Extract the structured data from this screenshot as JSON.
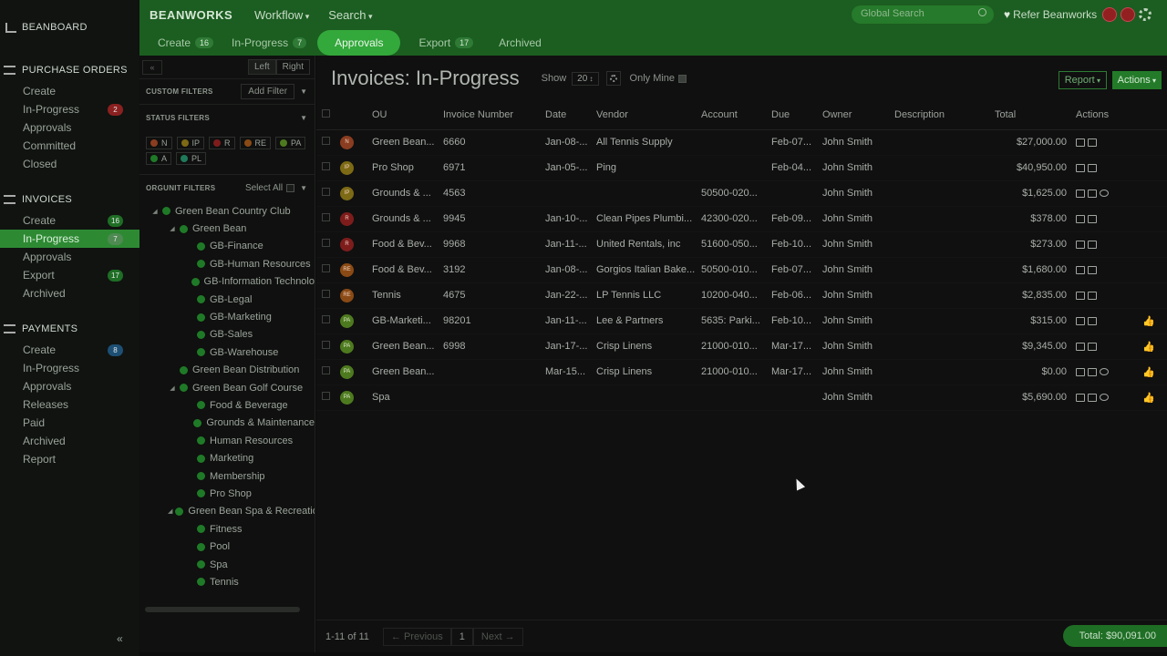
{
  "sidebar": {
    "home_label": "BEANBOARD",
    "purchase_orders": {
      "title": "PURCHASE ORDERS",
      "items": [
        {
          "label": "Create",
          "badge": ""
        },
        {
          "label": "In-Progress",
          "badge": "2"
        },
        {
          "label": "Approvals",
          "badge": ""
        },
        {
          "label": "Committed",
          "badge": ""
        },
        {
          "label": "Closed",
          "badge": ""
        }
      ]
    },
    "invoices": {
      "title": "INVOICES",
      "items": [
        {
          "label": "Create",
          "badge": "16"
        },
        {
          "label": "In-Progress",
          "badge": "7"
        },
        {
          "label": "Approvals",
          "badge": ""
        },
        {
          "label": "Export",
          "badge": "17"
        },
        {
          "label": "Archived",
          "badge": ""
        }
      ]
    },
    "payments": {
      "title": "PAYMENTS",
      "items": [
        {
          "label": "Create",
          "badge": "8"
        },
        {
          "label": "In-Progress",
          "badge": ""
        },
        {
          "label": "Approvals",
          "badge": ""
        },
        {
          "label": "Releases",
          "badge": ""
        },
        {
          "label": "Paid",
          "badge": ""
        },
        {
          "label": "Archived",
          "badge": ""
        },
        {
          "label": "Report",
          "badge": ""
        }
      ]
    },
    "collapse_label": "«"
  },
  "topbar": {
    "brand": "BEANWORKS",
    "menu": [
      "Workflow",
      "Search"
    ],
    "search_placeholder": "Global Search",
    "refer_label": "Refer Beanworks"
  },
  "subnav": {
    "tabs": [
      {
        "label": "Create",
        "count": "16"
      },
      {
        "label": "In-Progress",
        "count": "7"
      },
      {
        "label": "Approvals",
        "count": ""
      },
      {
        "label": "Export",
        "count": "17"
      },
      {
        "label": "Archived",
        "count": ""
      }
    ]
  },
  "filters": {
    "collapse": "«",
    "left": "Left",
    "right": "Right",
    "custom_title": "CUSTOM FILTERS",
    "add_filter": "Add Filter",
    "status_title": "STATUS FILTERS",
    "status_chips": [
      {
        "label": "N",
        "color": "#8a3d20"
      },
      {
        "label": "IP",
        "color": "#7d6a15"
      },
      {
        "label": "R",
        "color": "#7e1c1c"
      },
      {
        "label": "RE",
        "color": "#8a4a15"
      },
      {
        "label": "PA",
        "color": "#4e7a1f"
      },
      {
        "label": "A",
        "color": "#1f7a27"
      },
      {
        "label": "PL",
        "color": "#1f7a5a"
      }
    ],
    "orgunit_title": "ORGUNIT FILTERS",
    "select_all": "Select All",
    "tree": [
      {
        "label": "Green Bean Country Club",
        "level": 0,
        "toggle": "◢"
      },
      {
        "label": "Green Bean",
        "level": 1,
        "toggle": "◢"
      },
      {
        "label": "GB-Finance",
        "level": 2,
        "toggle": ""
      },
      {
        "label": "GB-Human Resources",
        "level": 2,
        "toggle": ""
      },
      {
        "label": "GB-Information Technolo",
        "level": 2,
        "toggle": ""
      },
      {
        "label": "GB-Legal",
        "level": 2,
        "toggle": ""
      },
      {
        "label": "GB-Marketing",
        "level": 2,
        "toggle": ""
      },
      {
        "label": "GB-Sales",
        "level": 2,
        "toggle": ""
      },
      {
        "label": "GB-Warehouse",
        "level": 2,
        "toggle": ""
      },
      {
        "label": "Green Bean Distribution",
        "level": 1,
        "toggle": ""
      },
      {
        "label": "Green Bean Golf Course",
        "level": 1,
        "toggle": "◢"
      },
      {
        "label": "Food & Beverage",
        "level": 2,
        "toggle": ""
      },
      {
        "label": "Grounds & Maintenance",
        "level": 2,
        "toggle": ""
      },
      {
        "label": "Human Resources",
        "level": 2,
        "toggle": ""
      },
      {
        "label": "Marketing",
        "level": 2,
        "toggle": ""
      },
      {
        "label": "Membership",
        "level": 2,
        "toggle": ""
      },
      {
        "label": "Pro Shop",
        "level": 2,
        "toggle": ""
      },
      {
        "label": "Green Bean Spa & Recreation",
        "level": 1,
        "toggle": "◢"
      },
      {
        "label": "Fitness",
        "level": 2,
        "toggle": ""
      },
      {
        "label": "Pool",
        "level": 2,
        "toggle": ""
      },
      {
        "label": "Spa",
        "level": 2,
        "toggle": ""
      },
      {
        "label": "Tennis",
        "level": 2,
        "toggle": ""
      }
    ]
  },
  "main": {
    "title": "Invoices: In-Progress",
    "show_label": "Show",
    "show_value": "20",
    "only_mine": "Only Mine",
    "report_btn": "Report",
    "actions_btn": "Actions",
    "columns": [
      "OU",
      "Invoice Number",
      "Date",
      "Vendor",
      "Account",
      "Due",
      "Owner",
      "Description",
      "Total",
      "Actions"
    ],
    "rows": [
      {
        "status": "N",
        "ou": "Green Bean...",
        "inv": "6660",
        "date": "Jan-08-...",
        "vendor": "All Tennis Supply",
        "account": "",
        "due": "Feb-07...",
        "owner": "John Smith",
        "desc": "",
        "total": "$27,000.00",
        "bubble": false,
        "thumb": false
      },
      {
        "status": "IP",
        "ou": "Pro Shop",
        "inv": "6971",
        "date": "Jan-05-...",
        "vendor": "Ping",
        "account": "",
        "due": "Feb-04...",
        "owner": "John Smith",
        "desc": "",
        "total": "$40,950.00",
        "bubble": false,
        "thumb": false
      },
      {
        "status": "IP",
        "ou": "Grounds & ...",
        "inv": "4563",
        "date": "",
        "vendor": "",
        "account": "50500-020...",
        "due": "",
        "owner": "John Smith",
        "desc": "",
        "total": "$1,625.00",
        "bubble": true,
        "thumb": false
      },
      {
        "status": "R",
        "ou": "Grounds & ...",
        "inv": "9945",
        "date": "Jan-10-...",
        "vendor": "Clean Pipes Plumbi...",
        "account": "42300-020...",
        "due": "Feb-09...",
        "owner": "John Smith",
        "desc": "",
        "total": "$378.00",
        "bubble": false,
        "thumb": false
      },
      {
        "status": "R",
        "ou": "Food & Bev...",
        "inv": "9968",
        "date": "Jan-11-...",
        "vendor": "United Rentals, inc",
        "account": "51600-050...",
        "due": "Feb-10...",
        "owner": "John Smith",
        "desc": "",
        "total": "$273.00",
        "bubble": false,
        "thumb": false
      },
      {
        "status": "RE",
        "ou": "Food & Bev...",
        "inv": "3192",
        "date": "Jan-08-...",
        "vendor": "Gorgios Italian Bake...",
        "account": "50500-010...",
        "due": "Feb-07...",
        "owner": "John Smith",
        "desc": "",
        "total": "$1,680.00",
        "bubble": false,
        "thumb": false
      },
      {
        "status": "RE",
        "ou": "Tennis",
        "inv": "4675",
        "date": "Jan-22-...",
        "vendor": "LP Tennis LLC",
        "account": "10200-040...",
        "due": "Feb-06...",
        "owner": "John Smith",
        "desc": "",
        "total": "$2,835.00",
        "bubble": false,
        "thumb": false
      },
      {
        "status": "PA",
        "ou": "GB-Marketi...",
        "inv": "98201",
        "date": "Jan-11-...",
        "vendor": "Lee & Partners",
        "account": "5635: Parki...",
        "due": "Feb-10...",
        "owner": "John Smith",
        "desc": "",
        "total": "$315.00",
        "bubble": false,
        "thumb": true
      },
      {
        "status": "PA",
        "ou": "Green Bean...",
        "inv": "6998",
        "date": "Jan-17-...",
        "vendor": "Crisp Linens",
        "account": "21000-010...",
        "due": "Mar-17...",
        "owner": "John Smith",
        "desc": "",
        "total": "$9,345.00",
        "bubble": false,
        "thumb": true
      },
      {
        "status": "PA",
        "ou": "Green Bean...",
        "inv": "",
        "date": "Mar-15...",
        "vendor": "Crisp Linens",
        "account": "21000-010...",
        "due": "Mar-17...",
        "owner": "John Smith",
        "desc": "",
        "total": "$0.00",
        "bubble": true,
        "thumb": true
      },
      {
        "status": "PA",
        "ou": "Spa",
        "inv": "",
        "date": "",
        "vendor": "",
        "account": "",
        "due": "",
        "owner": "John Smith",
        "desc": "",
        "total": "$5,690.00",
        "bubble": true,
        "thumb": true
      }
    ],
    "count_label": "1-11 of 11",
    "prev_label": "← Previous",
    "page_label": "1",
    "next_label": "Next →",
    "total_label": "Total: $90,091.00"
  }
}
